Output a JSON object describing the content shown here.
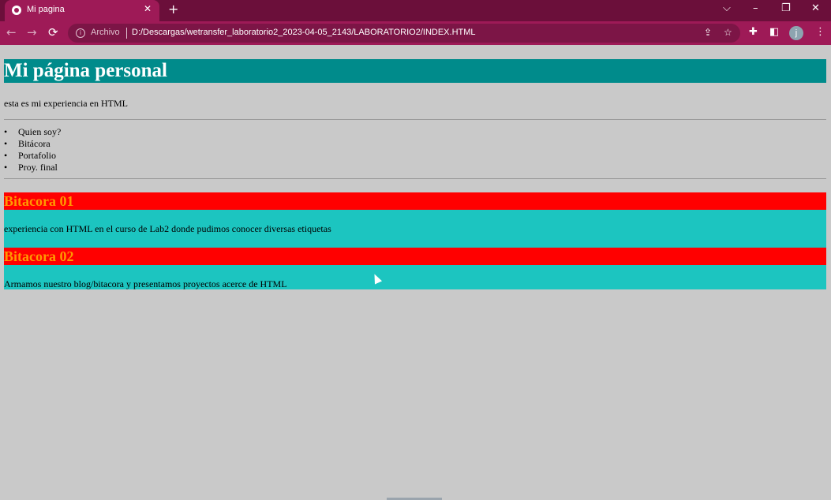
{
  "browser": {
    "tab_title": "Mi pagina",
    "tab_close": "✕",
    "new_tab": "+",
    "window_controls": {
      "tab_search": "⌵",
      "minimize": "–",
      "restore": "❐",
      "close": "✕"
    },
    "nav": {
      "back": "←",
      "forward": "→",
      "reload": "⟳"
    },
    "omnibox": {
      "info_icon": "i",
      "scheme_label": "Archivo",
      "url": "D:/Descargas/wetransfer_laboratorio2_2023-04-05_2143/LABORATORIO2/INDEX.HTML",
      "share_icon": "⇪",
      "star_icon": "☆"
    },
    "toolbar_icons": {
      "extensions": "✚",
      "side_panel": "◧",
      "menu": "⋮"
    },
    "profile_initial": "j"
  },
  "page": {
    "title": "Mi página personal",
    "intro": "esta es mi experiencia en HTML",
    "menu": [
      "Quien soy?",
      "Bitácora",
      "Portafolio",
      "Proy. final"
    ],
    "sections": [
      {
        "title": "Bitacora 01",
        "body": "experiencia con HTML en el curso de Lab2 donde pudimos conocer diversas etiquetas"
      },
      {
        "title": "Bitacora 02",
        "body": "Armamos nuestro blog/bitacora y presentamos proyectos acerce de HTML"
      }
    ]
  },
  "colors": {
    "tabbar": "#6b0f3a",
    "toolbar": "#9e1a57",
    "page_background": "#c9c9c9",
    "h1_background": "#008b8b",
    "section_title_background": "#ff0000",
    "section_title_text": "#ff9900",
    "section_body_background": "#1cc5c0"
  }
}
